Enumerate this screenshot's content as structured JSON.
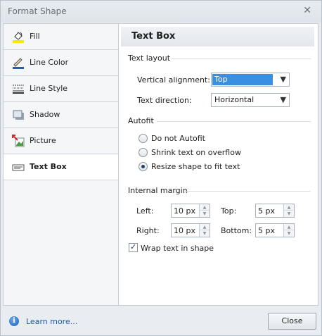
{
  "window": {
    "title": "Format Shape"
  },
  "sidebar": {
    "items": [
      {
        "label": "Fill",
        "icon": "fill-bucket-icon"
      },
      {
        "label": "Line Color",
        "icon": "line-color-icon"
      },
      {
        "label": "Line Style",
        "icon": "line-style-icon"
      },
      {
        "label": "Shadow",
        "icon": "shadow-icon"
      },
      {
        "label": "Picture",
        "icon": "picture-icon"
      },
      {
        "label": "Text Box",
        "icon": "text-box-icon",
        "selected": true
      }
    ]
  },
  "panel": {
    "title": "Text Box",
    "text_layout": {
      "heading": "Text layout",
      "vertical_alignment_label": "Vertical alignment:",
      "vertical_alignment_value": "Top",
      "text_direction_label": "Text direction:",
      "text_direction_value": "Horizontal"
    },
    "autofit": {
      "heading": "Autofit",
      "options": [
        "Do not Autofit",
        "Shrink text on overflow",
        "Resize shape to fit text"
      ],
      "selected": "Resize shape to fit text"
    },
    "internal_margin": {
      "heading": "Internal margin",
      "left_label": "Left:",
      "left_value": "10 px",
      "right_label": "Right:",
      "right_value": "10 px",
      "top_label": "Top:",
      "top_value": "5 px",
      "bottom_label": "Bottom:",
      "bottom_value": "5 px"
    },
    "wrap_text": {
      "label": "Wrap text in shape",
      "checked": true
    }
  },
  "footer": {
    "learn_more": "Learn more...",
    "close_label": "Close"
  },
  "colors": {
    "accent": "#3a8fe0",
    "link": "#1a5aa6",
    "fill_icon_yellow": "#ffe600"
  }
}
